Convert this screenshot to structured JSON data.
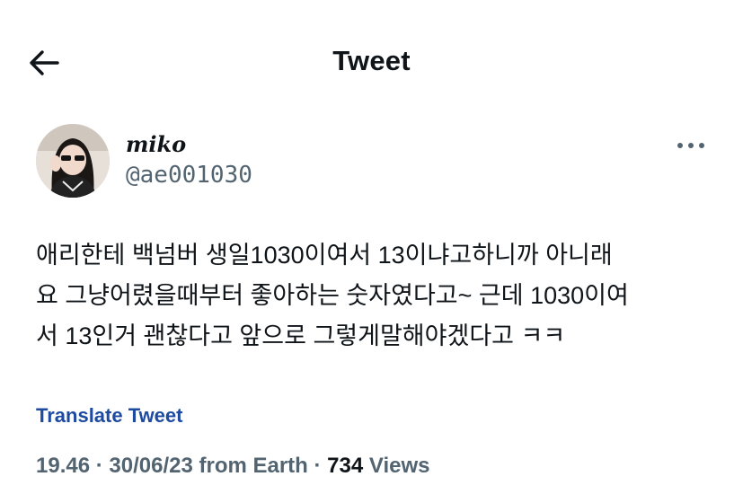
{
  "header": {
    "title": "Tweet",
    "back_icon": "arrow-left-icon"
  },
  "author": {
    "display_name": "miko",
    "handle": "@ae001030",
    "avatar": "avatar"
  },
  "more_icon": "more-horizontal-icon",
  "tweet": {
    "text_lines": [
      "애리한테 백넘버 생일1030이여서 13이냐고하니까 아니래",
      "요 그냥어렸을때부터 좋아하는 숫자였다고~ 근데 1030이여",
      "서 13인거 괜찮다고 앞으로 그렇게말해야겠다고 ㅋㅋ"
    ]
  },
  "translate_label": "Translate Tweet",
  "meta": {
    "time": "19.46",
    "sep1": " · ",
    "date": "30/06/23",
    "source": " from Earth",
    "sep2": " · ",
    "views_count": "734",
    "views_label": " Views"
  },
  "colors": {
    "text": "#0f1419",
    "secondary": "#536471",
    "link": "#1e4ba0",
    "background": "#ffffff"
  }
}
